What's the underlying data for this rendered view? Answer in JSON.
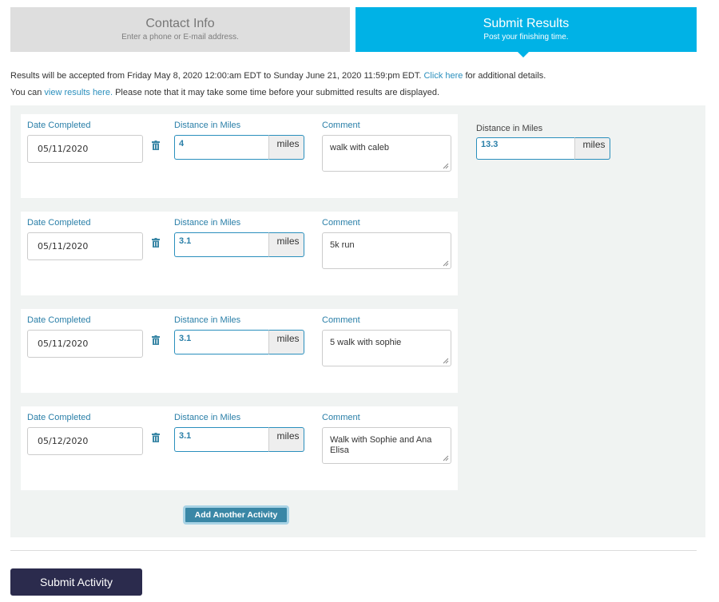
{
  "steps": {
    "contact": {
      "title": "Contact Info",
      "subtitle": "Enter a phone or E-mail address."
    },
    "submit": {
      "title": "Submit Results",
      "subtitle": "Post your finishing time."
    }
  },
  "info": {
    "line1_prefix": "Results will be accepted from Friday May 8, 2020 12:00:am EDT to Sunday June 21, 2020 11:59:pm EDT.",
    "line1_link": "Click here",
    "line1_suffix": "for additional details.",
    "line2_prefix": "You can",
    "line2_link": "view results here.",
    "line2_suffix": "Please note that it may take some time before your submitted results are displayed."
  },
  "labels": {
    "date": "Date Completed",
    "distance": "Distance in Miles",
    "comment": "Comment",
    "unit": "miles"
  },
  "icons": {
    "delete": "trash-icon"
  },
  "activities": [
    {
      "date": "05/11/2020",
      "distance": "4",
      "comment": "walk with caleb"
    },
    {
      "date": "05/11/2020",
      "distance": "3.1",
      "comment": "5k run"
    },
    {
      "date": "05/11/2020",
      "distance": "3.1",
      "comment": "5 walk with sophie"
    },
    {
      "date": "05/12/2020",
      "distance": "3.1",
      "comment": "Walk with Sophie and Ana Elisa"
    }
  ],
  "total": {
    "label": "Distance in Miles",
    "value": "13.3",
    "unit": "miles"
  },
  "buttons": {
    "add_activity": "Add Another Activity",
    "submit": "Submit Activity"
  },
  "colors": {
    "accent": "#00b2e6",
    "link": "#2a8fbd",
    "submit_button": "#2b2b4d",
    "add_button": "#3a87a6"
  }
}
